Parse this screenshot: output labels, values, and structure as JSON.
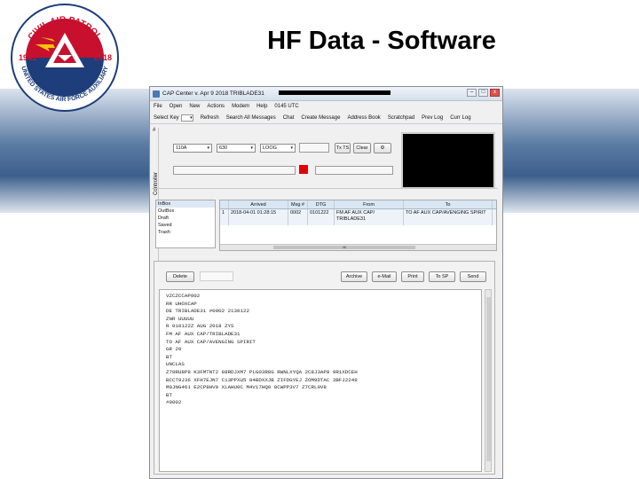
{
  "slide": {
    "title": "HF Data - Software",
    "logo": {
      "top_text": "CIVIL AIR PATROL",
      "bottom_text": "UNITED STATES AIR FORCE AUXILIARY",
      "year_left": "1941",
      "year_right": "2018"
    }
  },
  "window": {
    "title": "CAP Center v. Apr 9 2018  TRIBLADE31",
    "buttons": {
      "minimize": "–",
      "maximize": "□",
      "close": "x"
    }
  },
  "menu": [
    "File",
    "Open",
    "New",
    "Actions",
    "Modem",
    "Help",
    "0145 UTC"
  ],
  "toolbar": [
    "Refresh",
    "Search All Messages",
    "Chat",
    "Create Message",
    "Address Book",
    "Scratchpad",
    "Prev Log",
    "Curr Log"
  ],
  "select_key_label": "Select Key",
  "controller": {
    "hash": "#",
    "side_label": "Controller",
    "selects": [
      "110A",
      "630",
      "LOOG"
    ],
    "buttons": {
      "tx": "Tx TS",
      "clear": "Clear",
      "gear": "⚙"
    }
  },
  "folders": [
    "InBox",
    "OutBox",
    "Draft",
    "Saved",
    "Trash"
  ],
  "grid": {
    "headers": [
      "",
      "Arrived",
      "Msg #",
      "DTG",
      "From",
      "To"
    ],
    "rows": [
      [
        "1",
        "2018-04-01 01:28:15",
        "0002",
        "0101222",
        "FM AF AUX CAP/ TRIBLADE31",
        "TO AF AUX CAP/AVENGING SPIRIT"
      ]
    ],
    "hscroll_mark": "III"
  },
  "message_buttons": {
    "delete": "Delete",
    "archive": "Archive",
    "email": "e-Mail",
    "print": "Print",
    "to_sp": "To SP",
    "send": "Send"
  },
  "message_lines": [
    "VZCZCCAP002",
    "RR UHOXCAP",
    "DE TRIBLADE31 #0002 2130122",
    "ZNR UUUUU",
    "R 010122Z AUG 2018 ZYS",
    "FM AF AUX CAP/TRIBLADE31",
    "TO AF AUX CAP/AVENGING SPIRIT",
    "GR 20",
    "BT",
    "UNCLAS",
    "Z70RU8P8 K3FMTNT2 88RDJXM7 PLG03R8G RWNLXYQA 2C8J3AP8 9R1XDCEH",
    "BCCT9J36 XFH7EJN7 C13PPXU5 84BDXXJB ZIFDGYEJ ZOM9DTAC 3BFJ2249",
    "M0JNG461 E2CP8HV9 XLAHU0C M4V17HQ9 0CWPP3V7 Z7CRL0V8",
    "BT",
    "#0002"
  ]
}
